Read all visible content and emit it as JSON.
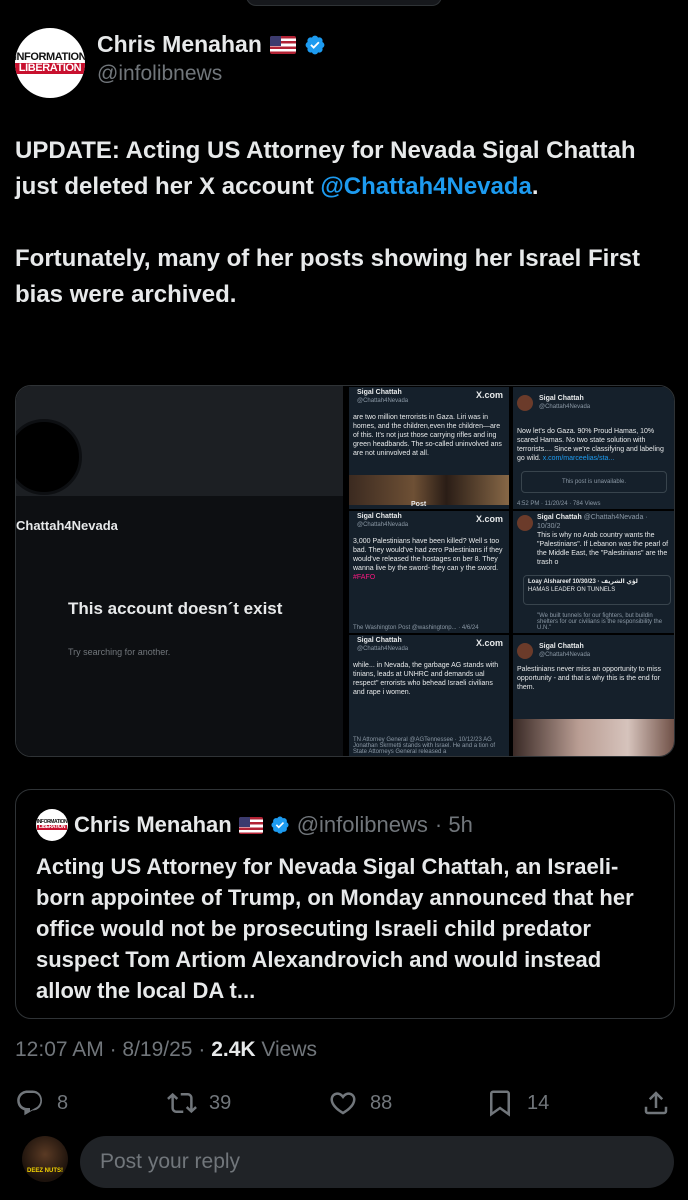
{
  "author": {
    "name": "Chris Menahan",
    "handle": "@infolibnews",
    "logo_top": "INFORMATION",
    "logo_bottom": "LIBERATION",
    "flag": "us-flag-emoji",
    "badge": "verified-badge-icon"
  },
  "tweet": {
    "line1": "UPDATE: Acting US Attorney for Nevada Sigal Chattah just deleted her X account",
    "mention": "@Chattah4Nevada",
    "after_mention": ".",
    "line2": "Fortunately, many of her posts showing her Israel First bias were archived."
  },
  "media": {
    "left": {
      "handle": "Chattah4Nevada",
      "title": "This account doesn´t exist",
      "subtitle": "Try searching for another."
    },
    "cells": [
      {
        "name": "Sigal Chattah",
        "handle": "@Chattah4Nevada",
        "site": "X.com",
        "body": "are two million terrorists in Gaza. Liri was in homes, and the children,even the children—are of this. It's not just those carrying rifles and ing green headbands. The so-called uninvolved ans are not uninvolved at all.",
        "label": "Post"
      },
      {
        "name": "Sigal Chattah",
        "handle": "@Chattah4Nevada",
        "body": "Now let's do Gaza. 90% Proud Hamas, 10% scared Hamas. No two state solution with terrorists.... Since we're classifying and labeling go wild.",
        "link": "x.com/marceelias/sta...",
        "unavailable": "This post is unavailable.",
        "footer": "4:52 PM · 11/20/24 · 784 Views"
      },
      {
        "name": "Sigal Chattah",
        "handle": "@Chattah4Nevada",
        "site": "X.com",
        "body": "3,000 Palestinians have been killed? Well s too bad. They would've had zero Palestinians if they would've released the hostages on ber 8. They wanna live by the sword- they can y the sword.",
        "tag": "#FAFO",
        "footer": "The Washington Post @washingtonp... · 4/6/24"
      },
      {
        "name": "Sigal Chattah",
        "handle": "@Chattah4Nevada · 10/30/2",
        "body": "This is why no Arab country wants the \"Palestinians\". If Lebanon was the pearl of the Middle East, the \"Palestinians\" are the trash o",
        "quote_name": "Loay Alshareef لؤي الشريف · 10/30/23",
        "quote_text": "HAMAS LEADER ON TUNNELS",
        "quote_body": "\"We built tunnels for our fighters, but buildin shelters for our civilians is the responsibility the U.N.\""
      },
      {
        "name": "Sigal Chattah",
        "handle": "@Chattah4Nevada",
        "site": "X.com",
        "body": "while... in Nevada, the garbage AG stands with tinians, leads at UNHRC and demands ual respect\" errorists who behead Israeli civilians and rape i women.",
        "footer": "TN Attorney General @AGTennessee · 10/12/23 AG Jonathan Skrmetti stands with Israel. He and a tion of State Attorneys General released a"
      },
      {
        "name": "Sigal Chattah",
        "handle": "@Chattah4Nevada",
        "body": "Palestinians never miss an opportunity to miss opportunity - and that is why this is the end for them."
      }
    ]
  },
  "quote": {
    "name": "Chris Menahan",
    "handle": "@infolibnews",
    "time": "· 5h",
    "text": "Acting US Attorney for Nevada Sigal Chattah, an Israeli-born appointee of Trump, on Monday announced that her office would not be prosecuting Israeli child predator suspect Tom Artiom Alexandrovich and would instead allow the local DA t..."
  },
  "meta": {
    "time": "12:07 AM",
    "sep": "·",
    "date": "8/19/25",
    "views_count": "2.4K",
    "views_label": "Views"
  },
  "actions": {
    "replies": "8",
    "reposts": "39",
    "likes": "88",
    "bookmarks": "14"
  },
  "reply": {
    "placeholder": "Post your reply",
    "avatar_text": "DEEZ NUTS!"
  },
  "colors": {
    "accent": "#1d9bf0",
    "muted": "#71767b",
    "text": "#e7e9ea",
    "background": "#000000"
  }
}
